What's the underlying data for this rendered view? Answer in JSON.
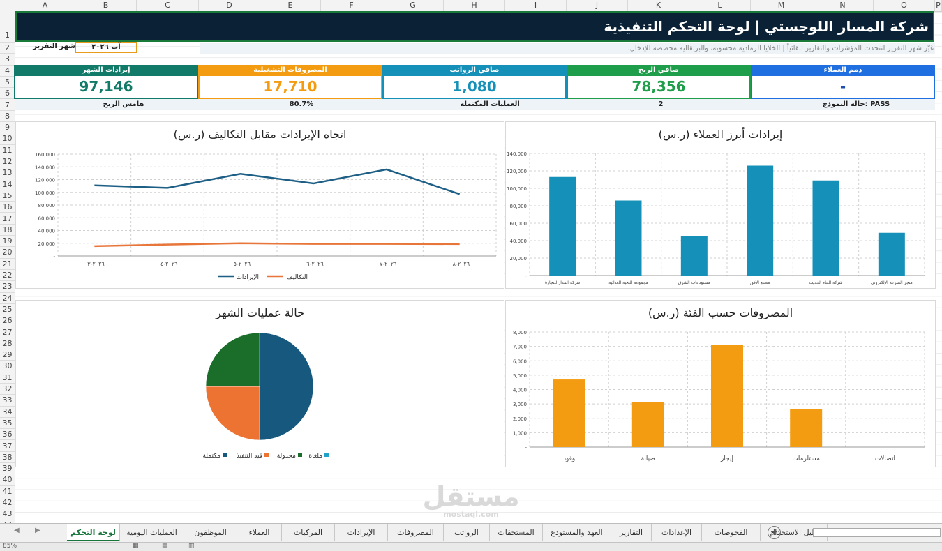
{
  "columns": [
    "A",
    "B",
    "C",
    "D",
    "E",
    "F",
    "G",
    "H",
    "I",
    "J",
    "K",
    "L",
    "M",
    "N",
    "O",
    "P"
  ],
  "rows": [
    "1",
    "2",
    "3",
    "4",
    "5",
    "6",
    "7",
    "8",
    "9",
    "10",
    "11",
    "12",
    "13",
    "14",
    "15",
    "16",
    "17",
    "18",
    "19",
    "20",
    "21",
    "22",
    "23",
    "24",
    "25",
    "26",
    "27",
    "28",
    "29",
    "30",
    "31",
    "32",
    "33",
    "34",
    "35",
    "36",
    "37",
    "38",
    "39",
    "40",
    "41",
    "42",
    "43",
    "44"
  ],
  "header": {
    "title": "شركة المسار اللوجستي | لوحة التحكم التنفيذية",
    "subtitle": "غيّر شهر التقرير لتتحدث المؤشرات والتقارير تلقائياً | الخلايا الرمادية محسوبة، والبرتقالية مخصصة للإدخال.",
    "month_label": "شهر التقرير",
    "month_value": "آب ٢٠٢٦"
  },
  "kpis": [
    {
      "label": "إيرادات الشهر",
      "value": "97,146",
      "color": "#117a68"
    },
    {
      "label": "المصروفات التشغيلية",
      "value": "17,710",
      "color": "#f39c12"
    },
    {
      "label": "صافي الرواتب",
      "value": "1,080",
      "color": "#1590b8"
    },
    {
      "label": "صافي الربح",
      "value": "78,356",
      "color": "#1e9e4a"
    },
    {
      "label": "ذمم العملاء",
      "value": "-",
      "color": "#1f6fe0"
    }
  ],
  "strip": {
    "margin_label": "هامش الربح",
    "margin_value": "80.7%",
    "ops_label": "العمليات المكتملة",
    "ops_value": "2",
    "status_text": "حالة النموذج: PASS"
  },
  "chart_data": [
    {
      "type": "line",
      "title": "اتجاه الإيرادات مقابل التكاليف (ر.س)",
      "x": [
        "٢٠٢٦-٠٣",
        "٢٠٢٦-٠٤",
        "٢٠٢٦-٠٥",
        "٢٠٢٦-٠٦",
        "٢٠٢٦-٠٧",
        "٢٠٢٦-٠٨"
      ],
      "series": [
        {
          "name": "الإيرادات",
          "values": [
            111000,
            107000,
            129000,
            114000,
            136000,
            97146
          ],
          "color": "#1e5f86"
        },
        {
          "name": "التكاليف",
          "values": [
            15500,
            18000,
            20000,
            19000,
            19000,
            18790
          ],
          "color": "#e8763a"
        }
      ],
      "yticks": [
        "-",
        "20,000",
        "40,000",
        "60,000",
        "80,000",
        "100,000",
        "120,000",
        "140,000",
        "160,000"
      ],
      "ylim": [
        0,
        160000
      ],
      "grid": true,
      "legend": "bottom"
    },
    {
      "type": "bar",
      "title": "إيرادات أبرز العملاء (ر.س)",
      "categories": [
        "شركة المدار للتجارة",
        "مجموعة النخبة الغذائية",
        "مستودعات الشرق",
        "مصنع الأفق",
        "شركة البناء الحديث",
        "متجر السرعة الإلكتروني"
      ],
      "values": [
        113000,
        86000,
        45000,
        126000,
        109000,
        49000
      ],
      "color": "#1590b8",
      "yticks": [
        "-",
        "20,000",
        "40,000",
        "60,000",
        "80,000",
        "100,000",
        "120,000",
        "140,000"
      ],
      "ylim": [
        0,
        140000
      ],
      "grid": true
    },
    {
      "type": "pie",
      "title": "حالة عمليات الشهر",
      "labels": [
        "مكتملة",
        "قيد التنفيذ",
        "مجدولة",
        "ملغاة"
      ],
      "values": [
        2,
        1,
        1,
        0
      ],
      "colors": [
        "#17587e",
        "#ec7332",
        "#1b6e2a",
        "#22a2c9"
      ],
      "legend": "bottom"
    },
    {
      "type": "bar",
      "title": "المصروفات حسب الفئة (ر.س)",
      "categories": [
        "وقود",
        "صيانة",
        "إيجار",
        "مستلزمات",
        "اتصالات"
      ],
      "values": [
        4700,
        3150,
        7100,
        2650,
        0
      ],
      "color": "#f39c12",
      "yticks": [
        "-",
        "1,000",
        "2,000",
        "3,000",
        "4,000",
        "5,000",
        "6,000",
        "7,000",
        "8,000"
      ],
      "ylim": [
        0,
        8000
      ],
      "grid": true
    }
  ],
  "tabs": [
    {
      "label": "لوحة التحكم",
      "active": true
    },
    {
      "label": "العمليات اليومية"
    },
    {
      "label": "الموظفون"
    },
    {
      "label": "العملاء"
    },
    {
      "label": "المركبات"
    },
    {
      "label": "الإيرادات"
    },
    {
      "label": "المصروفات"
    },
    {
      "label": "الرواتب"
    },
    {
      "label": "المستحقات"
    },
    {
      "label": "العهد والمستودع"
    },
    {
      "label": "التقارير"
    },
    {
      "label": "الإعدادات"
    },
    {
      "label": "الفحوصات"
    },
    {
      "label": "دليل الاستخدام"
    }
  ],
  "status": {
    "zoom": "85%"
  },
  "watermark": {
    "text": "مستقل",
    "sub": "mostaql.com"
  }
}
